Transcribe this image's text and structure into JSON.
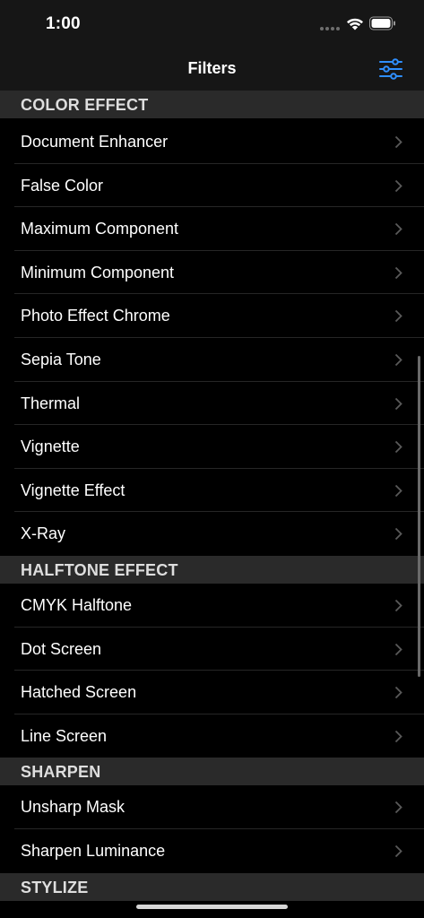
{
  "status_bar": {
    "time": "1:00"
  },
  "nav": {
    "title": "Filters",
    "filter_icon": "sliders-icon"
  },
  "colors": {
    "accent": "#2f8fff",
    "background": "#000000",
    "section_bg": "#2a2a2a"
  },
  "sections": [
    {
      "title": "COLOR EFFECT",
      "items": [
        "Document Enhancer",
        "False Color",
        "Maximum Component",
        "Minimum Component",
        "Photo Effect Chrome",
        "Sepia Tone",
        "Thermal",
        "Vignette",
        "Vignette Effect",
        "X-Ray"
      ]
    },
    {
      "title": "HALFTONE EFFECT",
      "items": [
        "CMYK Halftone",
        "Dot Screen",
        "Hatched Screen",
        "Line Screen"
      ]
    },
    {
      "title": "SHARPEN",
      "items": [
        "Unsharp Mask",
        "Sharpen Luminance"
      ]
    },
    {
      "title": "STYLIZE",
      "items": []
    }
  ]
}
